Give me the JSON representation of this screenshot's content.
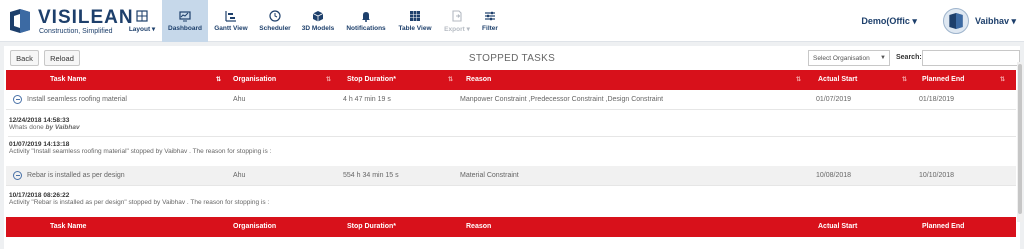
{
  "brand": {
    "name": "VISILEAN",
    "tagline": "Construction, Simplified"
  },
  "toolbar": [
    {
      "label": "Layout ▾",
      "icon": "layout-icon",
      "active": false,
      "disabled": false
    },
    {
      "label": "Dashboard",
      "icon": "dashboard-icon",
      "active": true,
      "disabled": false
    },
    {
      "label": "Gantt View",
      "icon": "gantt-icon",
      "active": false,
      "disabled": false
    },
    {
      "label": "Scheduler",
      "icon": "clock-icon",
      "active": false,
      "disabled": false
    },
    {
      "label": "3D Models",
      "icon": "cube-icon",
      "active": false,
      "disabled": false
    },
    {
      "label": "Notifications",
      "icon": "bell-icon",
      "active": false,
      "disabled": false
    },
    {
      "label": "Table View",
      "icon": "grid-icon",
      "active": false,
      "disabled": false
    },
    {
      "label": "Export ▾",
      "icon": "export-icon",
      "active": false,
      "disabled": true
    },
    {
      "label": "Filter",
      "icon": "filter-icon",
      "active": false,
      "disabled": false
    }
  ],
  "user": {
    "organisation": "Demo(Offic ▾",
    "name": "Vaibhav ▾"
  },
  "page": {
    "back_label": "Back",
    "reload_label": "Reload",
    "title": "STOPPED TASKS",
    "org_filter_placeholder": "Select Organisation",
    "search_label": "Search:"
  },
  "table": {
    "columns": [
      "Task Name",
      "Organisation",
      "Stop Duration*",
      "Reason",
      "Actual Start",
      "Planned End"
    ],
    "rows": [
      {
        "task": "Install seamless roofing material",
        "organisation": "Ahu",
        "duration": "4 h 47 min 19 s",
        "reason": "Manpower Constraint ,Predecessor Constraint ,Design Constraint",
        "actual_start": "01/07/2019",
        "planned_end": "01/18/2019",
        "logs": [
          {
            "date": "12/24/2018 14:58:33",
            "text": "Whats done ",
            "by": "by Vaibhav"
          },
          {
            "date": "01/07/2019 14:13:18",
            "text": "Activity \"Install seamless roofing material\" stopped by Vaibhav . The reason for stopping is :",
            "by": ""
          }
        ]
      },
      {
        "task": "Rebar is installed as per design",
        "organisation": "Ahu",
        "duration": "554 h 34 min 15 s",
        "reason": "Material Constraint",
        "actual_start": "10/08/2018",
        "planned_end": "10/10/2018",
        "logs": [
          {
            "date": "10/17/2018 08:26:22",
            "text": "Activity \"Rebar is installed as per design\" stopped by Vaibhav . The reason for stopping is :",
            "by": ""
          }
        ]
      }
    ]
  },
  "colors": {
    "header_red": "#d8111b",
    "brand_navy": "#1d3f6b",
    "active_tab": "#c6d8ea"
  }
}
